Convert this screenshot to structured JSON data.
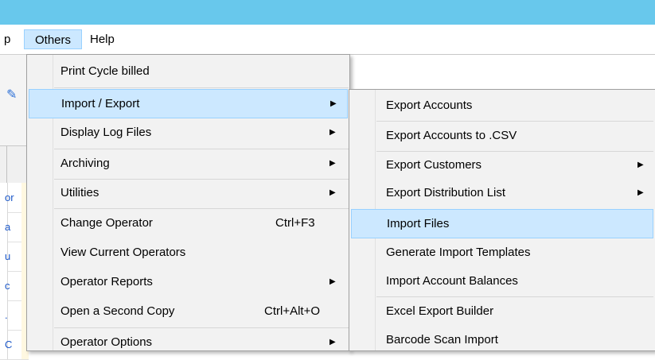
{
  "menubar": {
    "partial_item": "p",
    "others": "Others",
    "help": "Help"
  },
  "background": {
    "rows": [
      "or",
      "a",
      "u",
      "c",
      ".",
      "C"
    ]
  },
  "others_menu": {
    "items": [
      {
        "label": "Print Cycle billed",
        "shortcut": "",
        "submenu": false
      },
      {
        "label": "Import / Export",
        "shortcut": "",
        "submenu": true,
        "selected": true
      },
      {
        "label": "Display Log Files",
        "shortcut": "",
        "submenu": true
      },
      {
        "label": "Archiving",
        "shortcut": "",
        "submenu": true
      },
      {
        "label": "Utilities",
        "shortcut": "",
        "submenu": true
      },
      {
        "label": "Change Operator",
        "shortcut": "Ctrl+F3",
        "submenu": false
      },
      {
        "label": "View Current Operators",
        "shortcut": "",
        "submenu": false
      },
      {
        "label": "Operator Reports",
        "shortcut": "",
        "submenu": true
      },
      {
        "label": "Open a Second Copy",
        "shortcut": "Ctrl+Alt+O",
        "submenu": false
      },
      {
        "label": "Operator Options",
        "shortcut": "",
        "submenu": true
      }
    ]
  },
  "import_export_menu": {
    "items": [
      {
        "label": "Export Accounts",
        "submenu": false
      },
      {
        "label": "Export Accounts to .CSV",
        "submenu": false
      },
      {
        "label": "Export Customers",
        "submenu": true
      },
      {
        "label": "Export Distribution List",
        "submenu": true
      },
      {
        "label": "Import Files",
        "submenu": false,
        "selected": true
      },
      {
        "label": "Generate Import Templates",
        "submenu": false
      },
      {
        "label": "Import Account Balances",
        "submenu": false
      },
      {
        "label": "Excel Export Builder",
        "submenu": false
      },
      {
        "label": "Barcode Scan Import",
        "submenu": false
      }
    ]
  },
  "colors": {
    "titlebar": "#68c8ec",
    "highlight": "#cce8ff",
    "highlight_border": "#99d1ff",
    "menu_bg": "#f2f2f2"
  }
}
